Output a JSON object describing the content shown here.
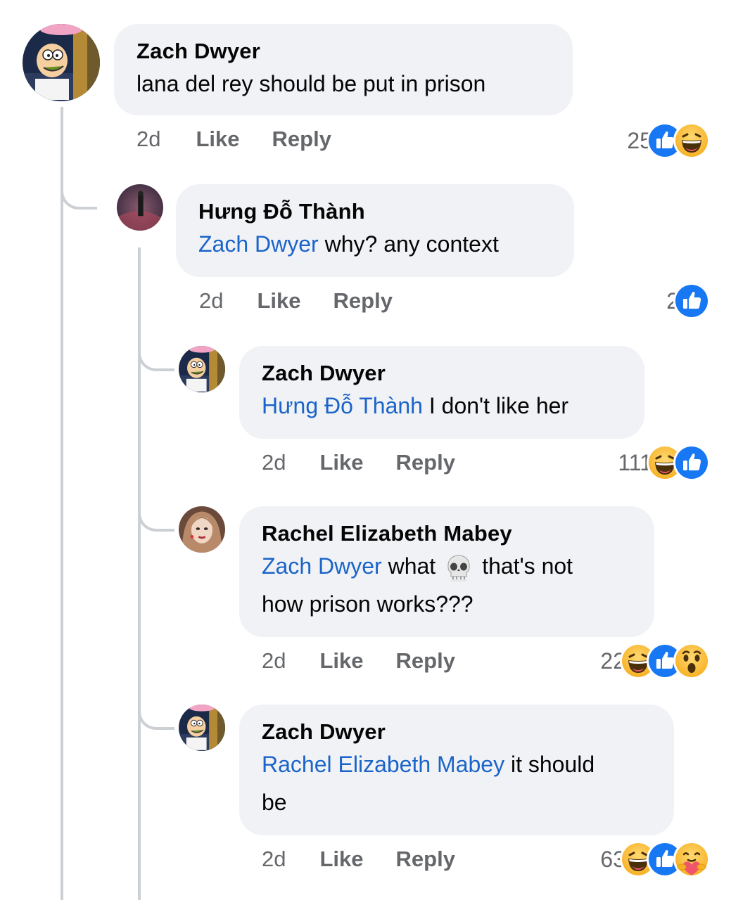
{
  "comments": [
    {
      "author": "Zach Dwyer",
      "mention": "",
      "text": "lana del rey should be put in prison",
      "time": "2d",
      "like": "Like",
      "reply": "Reply",
      "count": "25",
      "reactions": [
        "like-icon",
        "haha-icon"
      ]
    },
    {
      "author": "Hưng Đỗ Thành",
      "mention": "Zach Dwyer",
      "text": " why? any context",
      "time": "2d",
      "like": "Like",
      "reply": "Reply",
      "count": "2",
      "reactions": [
        "like-icon"
      ]
    },
    {
      "author": "Zach Dwyer",
      "mention": "Hưng Đỗ Thành",
      "text": " I don't like her",
      "time": "2d",
      "like": "Like",
      "reply": "Reply",
      "count": "111",
      "reactions": [
        "haha-icon",
        "like-icon"
      ]
    },
    {
      "author": "Rachel Elizabeth Mabey",
      "mention": "Zach Dwyer",
      "text_a": " what",
      "emoji": "skull-emoji",
      "text_b": "that's not",
      "text_c": "how prison works???",
      "time": "2d",
      "like": "Like",
      "reply": "Reply",
      "count": "22",
      "reactions": [
        "haha-icon",
        "like-icon",
        "wow-icon"
      ]
    },
    {
      "author": "Zach Dwyer",
      "mention": "Rachel Elizabeth Mabey",
      "text": " it should",
      "text_b": "be",
      "time": "2d",
      "like": "Like",
      "reply": "Reply",
      "count": "63",
      "reactions": [
        "haha-icon",
        "like-icon",
        "care-icon"
      ]
    }
  ],
  "colors": {
    "mention": "#1b64c9",
    "like": "#1877f2",
    "bubble": "#f0f2f5",
    "thread": "#ccd0d5"
  }
}
